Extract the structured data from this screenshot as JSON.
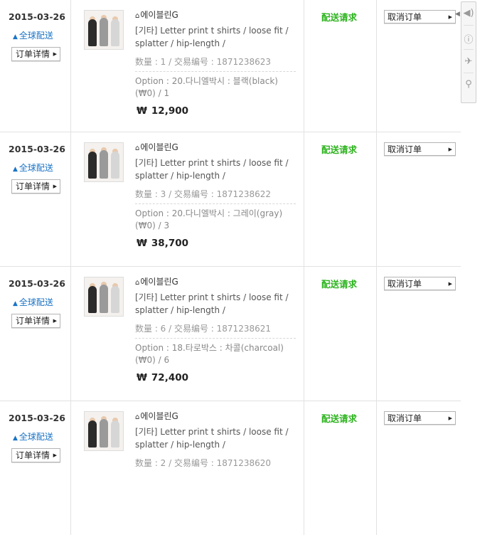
{
  "orders": [
    {
      "date": "2015-03-26",
      "shipping": "全球配送",
      "detail_label": "订单详情",
      "seller": "에이블린G",
      "title": "[기타] Letter print t shirts / loose fit / splatter / hip-length /",
      "meta": "数量 : 1 / 交易编号 : 1871238623",
      "option": "Option : 20.다니엘박시 : 블랙(black) (₩0) / 1",
      "currency": "₩",
      "price": "12,900",
      "status": "配送请求",
      "action_label": "取消订单"
    },
    {
      "date": "2015-03-26",
      "shipping": "全球配送",
      "detail_label": "订单详情",
      "seller": "에이블린G",
      "title": "[기타] Letter print t shirts / loose fit / splatter / hip-length /",
      "meta": "数量 : 3 / 交易编号 : 1871238622",
      "option": "Option : 20.다니엘박시 : 그레이(gray) (₩0) / 3",
      "currency": "₩",
      "price": "38,700",
      "status": "配送请求",
      "action_label": "取消订单"
    },
    {
      "date": "2015-03-26",
      "shipping": "全球配送",
      "detail_label": "订单详情",
      "seller": "에이블린G",
      "title": "[기타] Letter print t shirts / loose fit / splatter / hip-length /",
      "meta": "数量 : 6 / 交易编号 : 1871238621",
      "option": "Option : 18.타로박스 : 차콜(charcoal) (₩0) / 6",
      "currency": "₩",
      "price": "72,400",
      "status": "配送请求",
      "action_label": "取消订单"
    },
    {
      "date": "2015-03-26",
      "shipping": "全球配送",
      "detail_label": "订单详情",
      "seller": "에이블린G",
      "title": "[기타] Letter print t shirts / loose fit / splatter / hip-length /",
      "meta": "数量 : 2 / 交易编号 : 1871238620",
      "option": "",
      "currency": "₩",
      "price": "",
      "status": "配送请求",
      "action_label": "取消订单"
    }
  ],
  "side_toolbar": {
    "icons": [
      "speaker-icon",
      "info-icon",
      "airplane-icon",
      "search-icon"
    ]
  },
  "colors": {
    "status": "#2bb31c",
    "link": "#1a73c6",
    "divider": "#e2e2e2"
  }
}
